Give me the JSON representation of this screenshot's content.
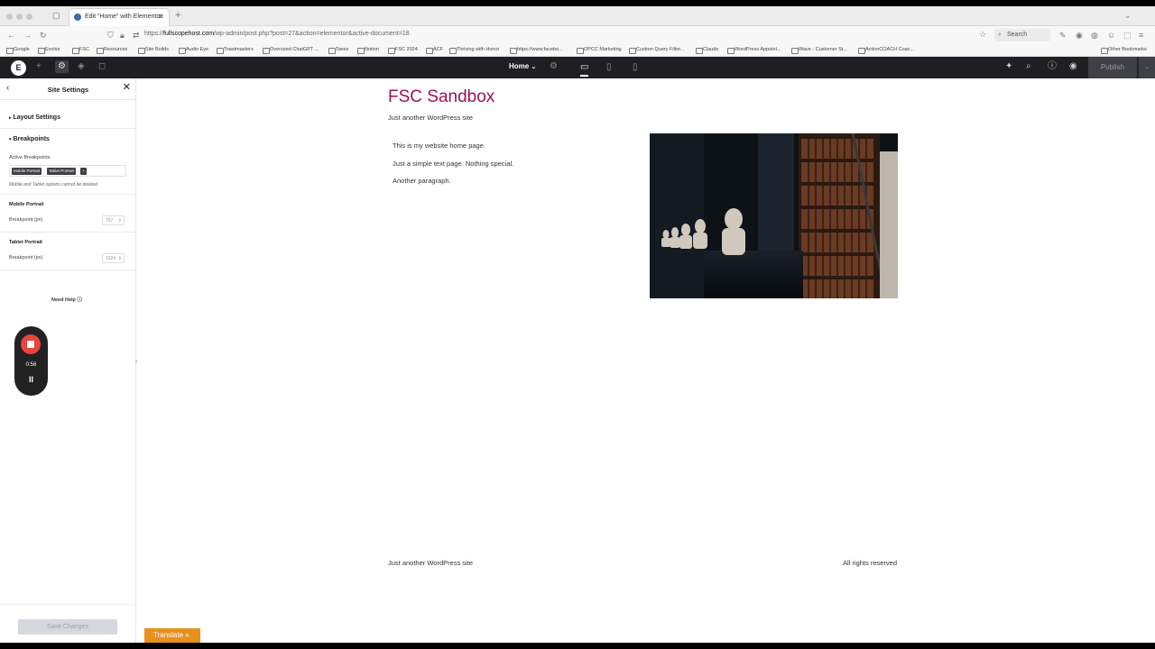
{
  "browser": {
    "tab_title": "Edit “Home” with Elementor",
    "new_tab": "+",
    "url_prefix": "https://",
    "url_domain": "fullscopehost.com",
    "url_path": "/wp-admin/post.php?post=27&action=elementor&active-document=18",
    "search_placeholder": "Search",
    "bookmarks": [
      "Google",
      "Evolve",
      "FSC",
      "Resources",
      "Site Builds",
      "Audio Eye",
      "Toastmasters",
      "Overused ChatGPT ...",
      "Taxes",
      "Notion",
      "FSC 2024",
      "ACF",
      "Thriving with Honor",
      "https://www.facebo...",
      "OPCC Marketing",
      "Custom Query Filter...",
      "Claude",
      "WordPress Appoint...",
      "Wave - Customer St...",
      "ActionCOACH Coac..."
    ],
    "other_bookmarks": "Other Bookmarks"
  },
  "editor": {
    "logo": "E",
    "page_selector": "Home",
    "publish_label": "Publish"
  },
  "panel": {
    "title": "Site Settings",
    "layout_settings": "Layout Settings",
    "breakpoints": "Breakpoints",
    "active_breakpoints_label": "Active Breakpoints",
    "chips": [
      "Mobile Portrait",
      "Tablet Portrait"
    ],
    "chip_add": "+",
    "note": "Mobile and Tablet options cannot be deleted.",
    "mobile_portrait": "Mobile Portrait",
    "mobile_breakpoint_label": "Breakpoint (px)",
    "mobile_breakpoint_value": "767",
    "tablet_portrait": "Tablet Portrait",
    "tablet_breakpoint_label": "Breakpoint (px)",
    "tablet_breakpoint_value": "1024",
    "need_help": "Need Help",
    "save_changes": "Save Changes"
  },
  "recorder": {
    "time": "0:56",
    "pause_symbol": "II"
  },
  "site": {
    "title": "FSC Sandbox",
    "tagline": "Just another WordPress site",
    "paragraphs": [
      "This is my website home page.",
      "Just a simple text page. Nothing special.",
      "Another paragraph."
    ],
    "footer_left": "Just another WordPress site",
    "footer_right": "All rights reserved"
  },
  "translate_label": "Translate »",
  "colors": {
    "site_title": "#9b1356",
    "editor_bar": "#1f1f23",
    "record": "#e8453c",
    "translate": "#e8911f"
  }
}
